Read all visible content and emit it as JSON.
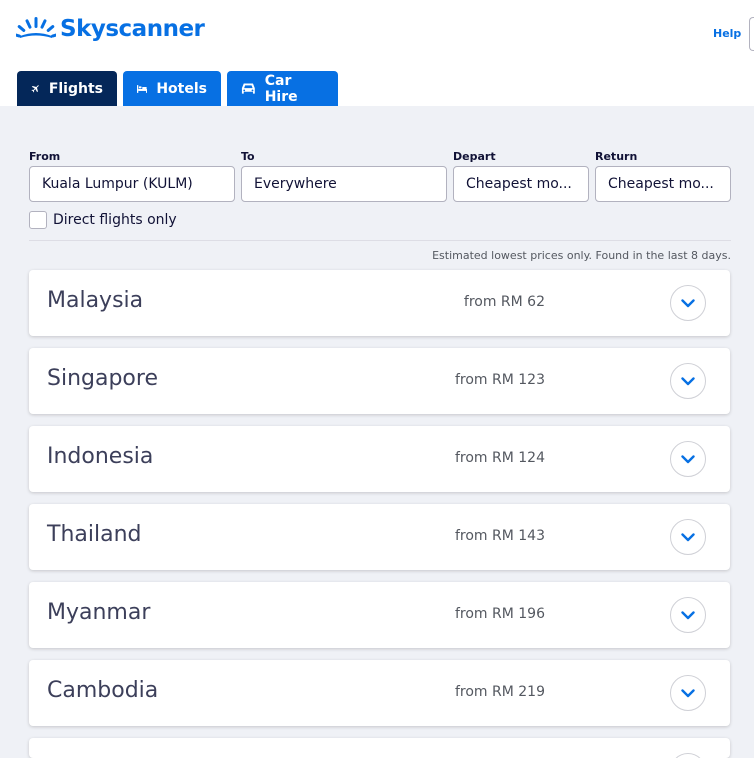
{
  "header": {
    "brand": "Skyscanner",
    "help": "Help"
  },
  "tabs": [
    {
      "label": "Flights",
      "icon": "plane-icon",
      "active": true
    },
    {
      "label": "Hotels",
      "icon": "bed-icon",
      "active": false
    },
    {
      "label": "Car Hire",
      "icon": "car-icon",
      "active": false
    }
  ],
  "search": {
    "from_label": "From",
    "from_value": "Kuala Lumpur (KULM)",
    "to_label": "To",
    "to_value": "Everywhere",
    "depart_label": "Depart",
    "depart_value": "Cheapest mo...",
    "return_label": "Return",
    "return_value": "Cheapest mo...",
    "direct_label": "Direct flights only",
    "direct_checked": false
  },
  "note": "Estimated lowest prices only. Found in the last 8 days.",
  "results": [
    {
      "country": "Malaysia",
      "price": "from RM 62"
    },
    {
      "country": "Singapore",
      "price": "from RM 123"
    },
    {
      "country": "Indonesia",
      "price": "from RM 124"
    },
    {
      "country": "Thailand",
      "price": "from RM 143"
    },
    {
      "country": "Myanmar",
      "price": "from RM 196"
    },
    {
      "country": "Cambodia",
      "price": "from RM 219"
    }
  ],
  "colors": {
    "brand_blue": "#0770e3",
    "active_tab": "#042759",
    "page_bg": "#eff1f6"
  }
}
